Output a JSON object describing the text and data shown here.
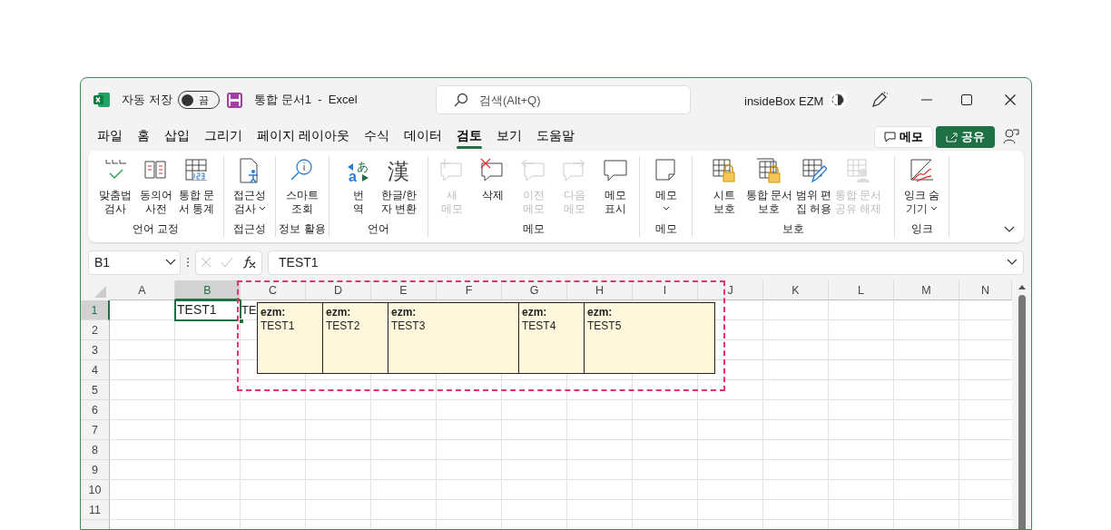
{
  "title_bar": {
    "autosave": {
      "label": "자동 저장",
      "toggle_text": "끔",
      "on": false
    },
    "document_title": "통합 문서1  -  Excel",
    "search": {
      "placeholder": "검색(Alt+Q)"
    },
    "user": "insideBox EZM"
  },
  "menu_tabs": [
    {
      "label": "파일",
      "selected": false
    },
    {
      "label": "홈",
      "selected": false
    },
    {
      "label": "삽입",
      "selected": false
    },
    {
      "label": "그리기",
      "selected": false
    },
    {
      "label": "페이지 레이아웃",
      "selected": false
    },
    {
      "label": "수식",
      "selected": false
    },
    {
      "label": "데이터",
      "selected": false
    },
    {
      "label": "검토",
      "selected": true
    },
    {
      "label": "보기",
      "selected": false
    },
    {
      "label": "도움말",
      "selected": false
    }
  ],
  "header_buttons": {
    "comments": "메모",
    "share": "공유"
  },
  "ribbon": [
    {
      "label": "언어 교정",
      "items": [
        {
          "text": "맞춤법\n검사",
          "disabled": false,
          "dropdown": false
        },
        {
          "text": "동의어\n사전",
          "disabled": false,
          "dropdown": false
        },
        {
          "text": "통합 문\n서 통계",
          "disabled": false,
          "dropdown": false
        }
      ]
    },
    {
      "label": "접근성",
      "items": [
        {
          "text": "접근성\n검사",
          "disabled": false,
          "dropdown": true
        }
      ]
    },
    {
      "label": "정보 활용",
      "items": [
        {
          "text": "스마트\n조회",
          "disabled": false,
          "dropdown": false
        }
      ]
    },
    {
      "label": "언어",
      "items": [
        {
          "text": "번\n역",
          "disabled": false,
          "dropdown": false,
          "icon_text": [
            "あ",
            "a"
          ]
        },
        {
          "text": "한글/한\n자 변환",
          "disabled": false,
          "dropdown": false,
          "icon_text": [
            "漢"
          ]
        }
      ]
    },
    {
      "label": "메모",
      "items": [
        {
          "text": "새\n메모",
          "disabled": true,
          "dropdown": false
        },
        {
          "text": "삭제",
          "disabled": false,
          "dropdown": false
        },
        {
          "text": "이전\n메모",
          "disabled": true,
          "dropdown": false
        },
        {
          "text": "다음\n메모",
          "disabled": true,
          "dropdown": false
        },
        {
          "text": "메모\n표시",
          "disabled": false,
          "dropdown": false
        }
      ]
    },
    {
      "label": "메모",
      "items": [
        {
          "text": "메모",
          "disabled": false,
          "dropdown": true
        }
      ]
    },
    {
      "label": "보호",
      "items": [
        {
          "text": "시트\n보호",
          "disabled": false,
          "dropdown": false
        },
        {
          "text": "통합 문서\n보호",
          "disabled": false,
          "dropdown": false
        },
        {
          "text": "범위 편\n집 허용",
          "disabled": false,
          "dropdown": false
        },
        {
          "text": "통합 문서\n공유 해제",
          "disabled": true,
          "dropdown": false
        }
      ]
    },
    {
      "label": "잉크",
      "items": [
        {
          "text": "잉크 숨\n기기",
          "disabled": false,
          "dropdown": true
        }
      ]
    }
  ],
  "formula_bar": {
    "name_box": "B1",
    "formula": "TEST1"
  },
  "sheet": {
    "columns": [
      "A",
      "B",
      "C",
      "D",
      "E",
      "F",
      "G",
      "H",
      "I",
      "J",
      "K",
      "L",
      "M",
      "N"
    ],
    "rows": [
      {
        "label": "1",
        "cells": {
          "B": {
            "text": "TEST1",
            "selected": true
          },
          "C": {
            "text": "TE",
            "selected": false
          }
        }
      },
      {
        "label": "2"
      },
      {
        "label": "3"
      },
      {
        "label": "4"
      },
      {
        "label": "5"
      },
      {
        "label": "6"
      },
      {
        "label": "7"
      },
      {
        "label": "8"
      },
      {
        "label": "9"
      },
      {
        "label": "10"
      },
      {
        "label": "11"
      }
    ],
    "comments": [
      {
        "author": "ezm:",
        "text": "TEST1"
      },
      {
        "author": "ezm:",
        "text": "TEST2"
      },
      {
        "author": "ezm:",
        "text": "TEST3"
      },
      {
        "author": "ezm:",
        "text": "TEST4"
      },
      {
        "author": "ezm:",
        "text": "TEST5"
      }
    ]
  }
}
